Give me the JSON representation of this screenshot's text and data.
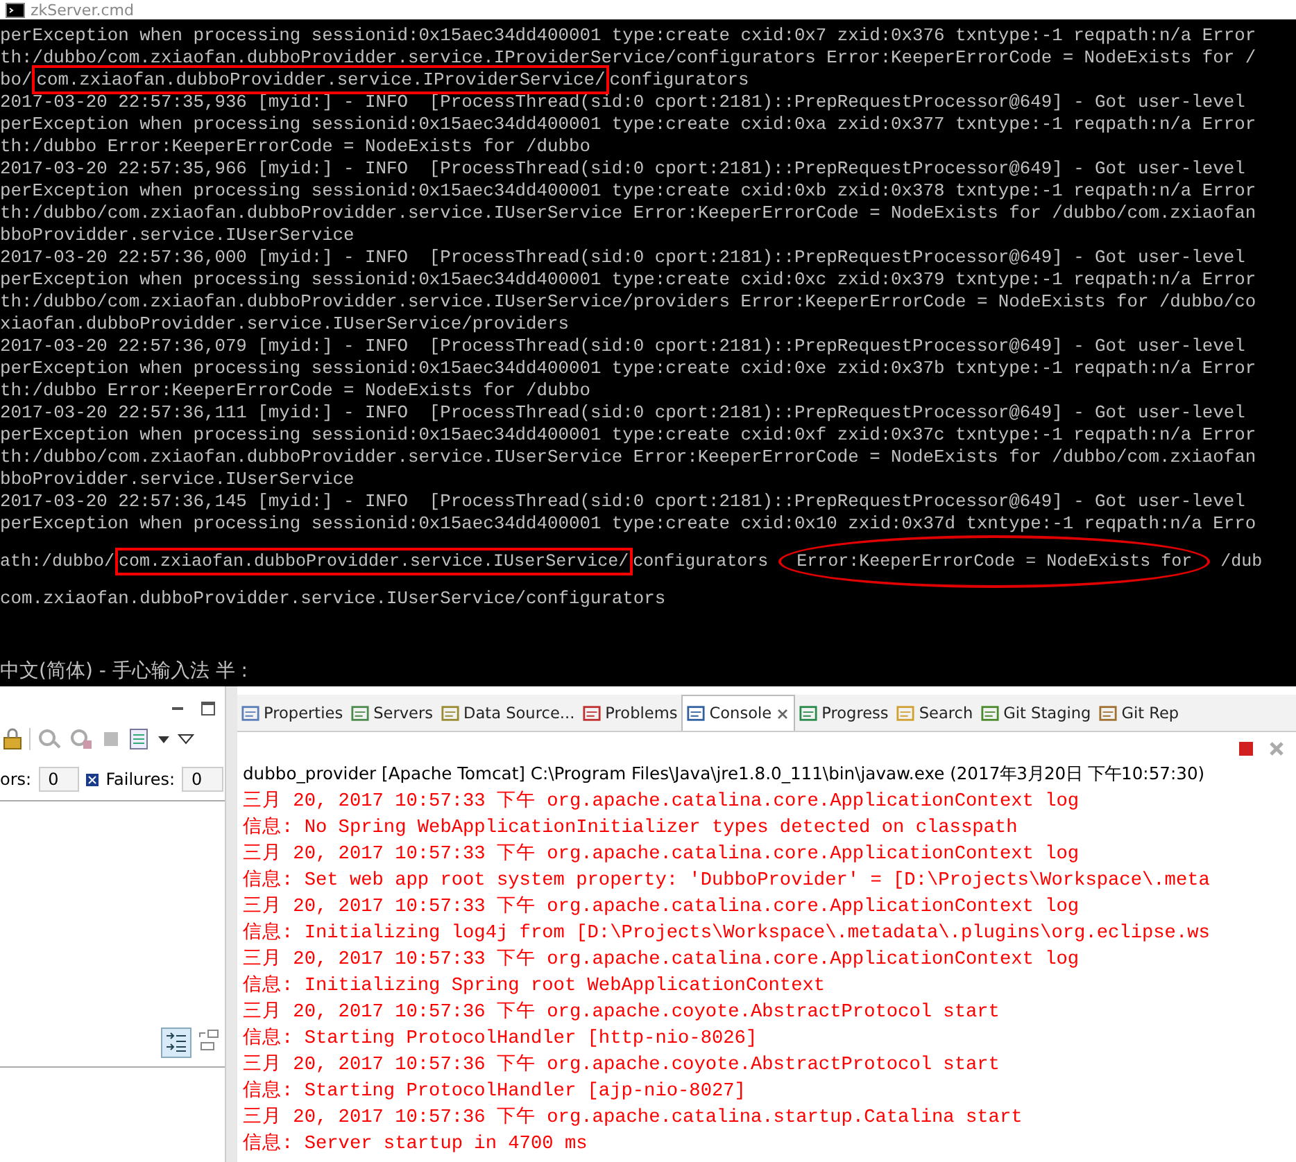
{
  "terminal": {
    "title": "zkServer.cmd",
    "lines": [
      {
        "text": "perException when processing sessionid:0x15aec34dd400001 type:create cxid:0x7 zxid:0x376 txntype:-1 reqpath:n/a Error"
      },
      {
        "text": "th:/dubbo/com.zxiaofan.dubboProvidder.service.IProviderService/configurators Error:KeeperErrorCode = NodeExists for /"
      },
      {
        "segments": [
          {
            "text": "bo/",
            "kind": "plain"
          },
          {
            "text": "com.zxiaofan.dubboProvidder.service.IProviderService/",
            "kind": "boxed"
          },
          {
            "text": "configurators",
            "kind": "plain"
          }
        ]
      },
      {
        "text": "2017-03-20 22:57:35,936 [myid:] - INFO  [ProcessThread(sid:0 cport:2181)::PrepRequestProcessor@649] - Got user-level"
      },
      {
        "text": "perException when processing sessionid:0x15aec34dd400001 type:create cxid:0xa zxid:0x377 txntype:-1 reqpath:n/a Error"
      },
      {
        "text": "th:/dubbo Error:KeeperErrorCode = NodeExists for /dubbo"
      },
      {
        "text": "2017-03-20 22:57:35,966 [myid:] - INFO  [ProcessThread(sid:0 cport:2181)::PrepRequestProcessor@649] - Got user-level"
      },
      {
        "text": "perException when processing sessionid:0x15aec34dd400001 type:create cxid:0xb zxid:0x378 txntype:-1 reqpath:n/a Error"
      },
      {
        "text": "th:/dubbo/com.zxiaofan.dubboProvidder.service.IUserService Error:KeeperErrorCode = NodeExists for /dubbo/com.zxiaofan"
      },
      {
        "text": "bboProvidder.service.IUserService"
      },
      {
        "text": "2017-03-20 22:57:36,000 [myid:] - INFO  [ProcessThread(sid:0 cport:2181)::PrepRequestProcessor@649] - Got user-level"
      },
      {
        "text": "perException when processing sessionid:0x15aec34dd400001 type:create cxid:0xc zxid:0x379 txntype:-1 reqpath:n/a Error"
      },
      {
        "text": "th:/dubbo/com.zxiaofan.dubboProvidder.service.IUserService/providers Error:KeeperErrorCode = NodeExists for /dubbo/co"
      },
      {
        "text": "xiaofan.dubboProvidder.service.IUserService/providers"
      },
      {
        "text": "2017-03-20 22:57:36,079 [myid:] - INFO  [ProcessThread(sid:0 cport:2181)::PrepRequestProcessor@649] - Got user-level"
      },
      {
        "text": "perException when processing sessionid:0x15aec34dd400001 type:create cxid:0xe zxid:0x37b txntype:-1 reqpath:n/a Error"
      },
      {
        "text": "th:/dubbo Error:KeeperErrorCode = NodeExists for /dubbo"
      },
      {
        "text": "2017-03-20 22:57:36,111 [myid:] - INFO  [ProcessThread(sid:0 cport:2181)::PrepRequestProcessor@649] - Got user-level"
      },
      {
        "text": "perException when processing sessionid:0x15aec34dd400001 type:create cxid:0xf zxid:0x37c txntype:-1 reqpath:n/a Error"
      },
      {
        "text": "th:/dubbo/com.zxiaofan.dubboProvidder.service.IUserService Error:KeeperErrorCode = NodeExists for /dubbo/com.zxiaofan"
      },
      {
        "text": "bboProvidder.service.IUserService"
      },
      {
        "text": "2017-03-20 22:57:36,145 [myid:] - INFO  [ProcessThread(sid:0 cport:2181)::PrepRequestProcessor@649] - Got user-level"
      },
      {
        "text": "perException when processing sessionid:0x15aec34dd400001 type:create cxid:0x10 zxid:0x37d txntype:-1 reqpath:n/a Erro"
      },
      {
        "segments": [
          {
            "text": "ath:/dubbo/",
            "kind": "plain"
          },
          {
            "text": "com.zxiaofan.dubboProvidder.service.IUserService/",
            "kind": "boxed"
          },
          {
            "text": "configurators ",
            "kind": "plain"
          },
          {
            "text": "Error:KeeperErrorCode = NodeExists for",
            "kind": "circled"
          },
          {
            "text": " /dub",
            "kind": "plain"
          }
        ]
      },
      {
        "text": "com.zxiaofan.dubboProvidder.service.IUserService/configurators"
      }
    ],
    "ime_status": "中文(简体) - 手心输入法 半 :"
  },
  "junit": {
    "runs_label": "ors:",
    "runs_value": "0",
    "failures_label": "Failures:",
    "failures_value": "0"
  },
  "tabs": [
    {
      "label": "Properties",
      "selected": false
    },
    {
      "label": "Servers",
      "selected": false
    },
    {
      "label": "Data Source...",
      "selected": false
    },
    {
      "label": "Problems",
      "selected": false
    },
    {
      "label": "Console",
      "selected": true
    },
    {
      "label": "Progress",
      "selected": false
    },
    {
      "label": "Search",
      "selected": false
    },
    {
      "label": "Git Staging",
      "selected": false
    },
    {
      "label": "Git Rep",
      "selected": false
    }
  ],
  "console": {
    "header": "dubbo_provider [Apache Tomcat] C:\\Program Files\\Java\\jre1.8.0_111\\bin\\javaw.exe (2017年3月20日 下午10:57:30)",
    "lines": [
      "三月 20, 2017 10:57:33 下午 org.apache.catalina.core.ApplicationContext log",
      "信息: No Spring WebApplicationInitializer types detected on classpath",
      "三月 20, 2017 10:57:33 下午 org.apache.catalina.core.ApplicationContext log",
      "信息: Set web app root system property: 'DubboProvider' = [D:\\Projects\\Workspace\\.meta",
      "三月 20, 2017 10:57:33 下午 org.apache.catalina.core.ApplicationContext log",
      "信息: Initializing log4j from [D:\\Projects\\Workspace\\.metadata\\.plugins\\org.eclipse.ws",
      "三月 20, 2017 10:57:33 下午 org.apache.catalina.core.ApplicationContext log",
      "信息: Initializing Spring root WebApplicationContext",
      "三月 20, 2017 10:57:36 下午 org.apache.coyote.AbstractProtocol start",
      "信息: Starting ProtocolHandler [http-nio-8026]",
      "三月 20, 2017 10:57:36 下午 org.apache.coyote.AbstractProtocol start",
      "信息: Starting ProtocolHandler [ajp-nio-8027]",
      "三月 20, 2017 10:57:36 下午 org.apache.catalina.startup.Catalina start",
      "信息: Server startup in 4700 ms"
    ]
  }
}
